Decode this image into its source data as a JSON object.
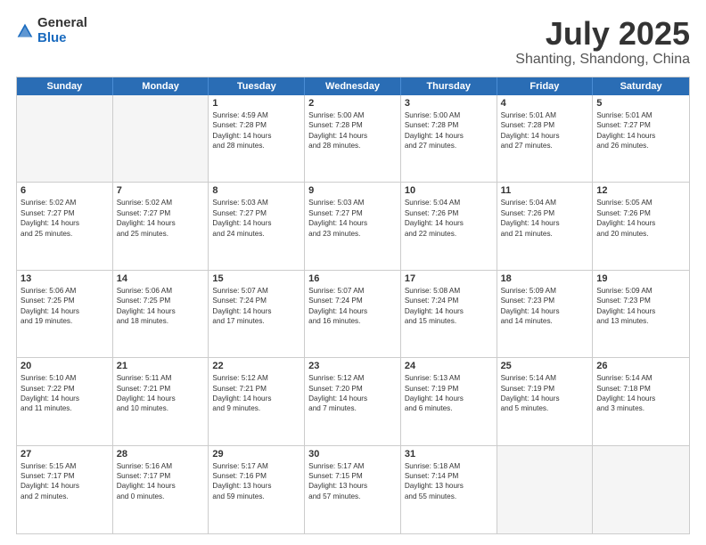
{
  "logo": {
    "general": "General",
    "blue": "Blue"
  },
  "header": {
    "month": "July 2025",
    "location": "Shanting, Shandong, China"
  },
  "weekdays": [
    "Sunday",
    "Monday",
    "Tuesday",
    "Wednesday",
    "Thursday",
    "Friday",
    "Saturday"
  ],
  "weeks": [
    [
      {
        "day": "",
        "lines": []
      },
      {
        "day": "",
        "lines": []
      },
      {
        "day": "1",
        "lines": [
          "Sunrise: 4:59 AM",
          "Sunset: 7:28 PM",
          "Daylight: 14 hours",
          "and 28 minutes."
        ]
      },
      {
        "day": "2",
        "lines": [
          "Sunrise: 5:00 AM",
          "Sunset: 7:28 PM",
          "Daylight: 14 hours",
          "and 28 minutes."
        ]
      },
      {
        "day": "3",
        "lines": [
          "Sunrise: 5:00 AM",
          "Sunset: 7:28 PM",
          "Daylight: 14 hours",
          "and 27 minutes."
        ]
      },
      {
        "day": "4",
        "lines": [
          "Sunrise: 5:01 AM",
          "Sunset: 7:28 PM",
          "Daylight: 14 hours",
          "and 27 minutes."
        ]
      },
      {
        "day": "5",
        "lines": [
          "Sunrise: 5:01 AM",
          "Sunset: 7:27 PM",
          "Daylight: 14 hours",
          "and 26 minutes."
        ]
      }
    ],
    [
      {
        "day": "6",
        "lines": [
          "Sunrise: 5:02 AM",
          "Sunset: 7:27 PM",
          "Daylight: 14 hours",
          "and 25 minutes."
        ]
      },
      {
        "day": "7",
        "lines": [
          "Sunrise: 5:02 AM",
          "Sunset: 7:27 PM",
          "Daylight: 14 hours",
          "and 25 minutes."
        ]
      },
      {
        "day": "8",
        "lines": [
          "Sunrise: 5:03 AM",
          "Sunset: 7:27 PM",
          "Daylight: 14 hours",
          "and 24 minutes."
        ]
      },
      {
        "day": "9",
        "lines": [
          "Sunrise: 5:03 AM",
          "Sunset: 7:27 PM",
          "Daylight: 14 hours",
          "and 23 minutes."
        ]
      },
      {
        "day": "10",
        "lines": [
          "Sunrise: 5:04 AM",
          "Sunset: 7:26 PM",
          "Daylight: 14 hours",
          "and 22 minutes."
        ]
      },
      {
        "day": "11",
        "lines": [
          "Sunrise: 5:04 AM",
          "Sunset: 7:26 PM",
          "Daylight: 14 hours",
          "and 21 minutes."
        ]
      },
      {
        "day": "12",
        "lines": [
          "Sunrise: 5:05 AM",
          "Sunset: 7:26 PM",
          "Daylight: 14 hours",
          "and 20 minutes."
        ]
      }
    ],
    [
      {
        "day": "13",
        "lines": [
          "Sunrise: 5:06 AM",
          "Sunset: 7:25 PM",
          "Daylight: 14 hours",
          "and 19 minutes."
        ]
      },
      {
        "day": "14",
        "lines": [
          "Sunrise: 5:06 AM",
          "Sunset: 7:25 PM",
          "Daylight: 14 hours",
          "and 18 minutes."
        ]
      },
      {
        "day": "15",
        "lines": [
          "Sunrise: 5:07 AM",
          "Sunset: 7:24 PM",
          "Daylight: 14 hours",
          "and 17 minutes."
        ]
      },
      {
        "day": "16",
        "lines": [
          "Sunrise: 5:07 AM",
          "Sunset: 7:24 PM",
          "Daylight: 14 hours",
          "and 16 minutes."
        ]
      },
      {
        "day": "17",
        "lines": [
          "Sunrise: 5:08 AM",
          "Sunset: 7:24 PM",
          "Daylight: 14 hours",
          "and 15 minutes."
        ]
      },
      {
        "day": "18",
        "lines": [
          "Sunrise: 5:09 AM",
          "Sunset: 7:23 PM",
          "Daylight: 14 hours",
          "and 14 minutes."
        ]
      },
      {
        "day": "19",
        "lines": [
          "Sunrise: 5:09 AM",
          "Sunset: 7:23 PM",
          "Daylight: 14 hours",
          "and 13 minutes."
        ]
      }
    ],
    [
      {
        "day": "20",
        "lines": [
          "Sunrise: 5:10 AM",
          "Sunset: 7:22 PM",
          "Daylight: 14 hours",
          "and 11 minutes."
        ]
      },
      {
        "day": "21",
        "lines": [
          "Sunrise: 5:11 AM",
          "Sunset: 7:21 PM",
          "Daylight: 14 hours",
          "and 10 minutes."
        ]
      },
      {
        "day": "22",
        "lines": [
          "Sunrise: 5:12 AM",
          "Sunset: 7:21 PM",
          "Daylight: 14 hours",
          "and 9 minutes."
        ]
      },
      {
        "day": "23",
        "lines": [
          "Sunrise: 5:12 AM",
          "Sunset: 7:20 PM",
          "Daylight: 14 hours",
          "and 7 minutes."
        ]
      },
      {
        "day": "24",
        "lines": [
          "Sunrise: 5:13 AM",
          "Sunset: 7:19 PM",
          "Daylight: 14 hours",
          "and 6 minutes."
        ]
      },
      {
        "day": "25",
        "lines": [
          "Sunrise: 5:14 AM",
          "Sunset: 7:19 PM",
          "Daylight: 14 hours",
          "and 5 minutes."
        ]
      },
      {
        "day": "26",
        "lines": [
          "Sunrise: 5:14 AM",
          "Sunset: 7:18 PM",
          "Daylight: 14 hours",
          "and 3 minutes."
        ]
      }
    ],
    [
      {
        "day": "27",
        "lines": [
          "Sunrise: 5:15 AM",
          "Sunset: 7:17 PM",
          "Daylight: 14 hours",
          "and 2 minutes."
        ]
      },
      {
        "day": "28",
        "lines": [
          "Sunrise: 5:16 AM",
          "Sunset: 7:17 PM",
          "Daylight: 14 hours",
          "and 0 minutes."
        ]
      },
      {
        "day": "29",
        "lines": [
          "Sunrise: 5:17 AM",
          "Sunset: 7:16 PM",
          "Daylight: 13 hours",
          "and 59 minutes."
        ]
      },
      {
        "day": "30",
        "lines": [
          "Sunrise: 5:17 AM",
          "Sunset: 7:15 PM",
          "Daylight: 13 hours",
          "and 57 minutes."
        ]
      },
      {
        "day": "31",
        "lines": [
          "Sunrise: 5:18 AM",
          "Sunset: 7:14 PM",
          "Daylight: 13 hours",
          "and 55 minutes."
        ]
      },
      {
        "day": "",
        "lines": []
      },
      {
        "day": "",
        "lines": []
      }
    ]
  ]
}
